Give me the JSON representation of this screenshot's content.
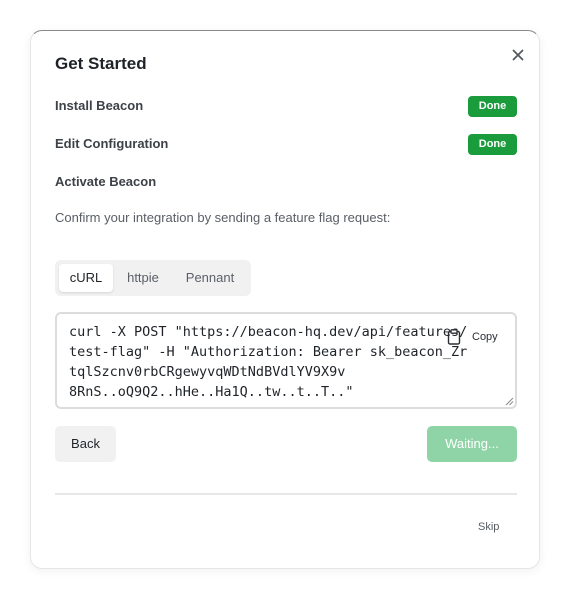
{
  "dialog": {
    "title": "Get Started",
    "close_icon": "close-icon"
  },
  "steps": [
    {
      "label": "Install Beacon",
      "status": "Done"
    },
    {
      "label": "Edit Configuration",
      "status": "Done"
    },
    {
      "label": "Activate Beacon",
      "status": ""
    }
  ],
  "description": "Confirm your integration by sending a feature flag request:",
  "tabs": [
    {
      "label": "cURL",
      "active": true
    },
    {
      "label": "httpie",
      "active": false
    },
    {
      "label": "Pennant",
      "active": false
    }
  ],
  "code": {
    "text": "curl -X POST \"https://beacon-hq.dev/api/features/test-flag\" -H \"Authorization: Bearer sk_beacon_ZrtqlSzcnv0rbCRgewyvqWDtNdBVdlYV9X9v\n8RnS..oQ9Q2..hHe..Ha1Q..tw..t..T..\"",
    "copy_label": "Copy",
    "copy_icon": "clipboard-icon"
  },
  "buttons": {
    "back": "Back",
    "waiting": "Waiting..."
  },
  "footer": {
    "skip": "Skip"
  },
  "colors": {
    "done_badge": "#1a9b3c",
    "waiting_button": "#8fd4a6"
  }
}
